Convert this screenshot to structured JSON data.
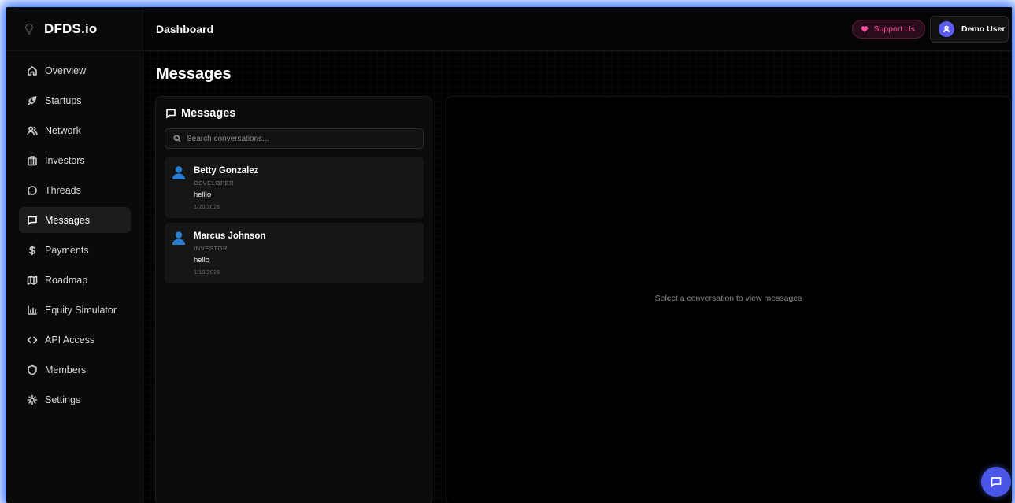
{
  "brand": {
    "name": "DFDS.io"
  },
  "sidebar": {
    "items": [
      {
        "label": "Overview",
        "icon": "home-icon"
      },
      {
        "label": "Startups",
        "icon": "rocket-icon"
      },
      {
        "label": "Network",
        "icon": "users-icon"
      },
      {
        "label": "Investors",
        "icon": "building-icon"
      },
      {
        "label": "Threads",
        "icon": "chat-bubble-icon"
      },
      {
        "label": "Messages",
        "icon": "message-square-icon",
        "active": true
      },
      {
        "label": "Payments",
        "icon": "dollar-icon"
      },
      {
        "label": "Roadmap",
        "icon": "map-icon"
      },
      {
        "label": "Equity Simulator",
        "icon": "bar-chart-icon"
      },
      {
        "label": "API Access",
        "icon": "code-icon"
      },
      {
        "label": "Members",
        "icon": "shield-icon"
      },
      {
        "label": "Settings",
        "icon": "gear-icon"
      }
    ]
  },
  "header": {
    "title": "Dashboard",
    "support_label": "Support Us",
    "user_name": "Demo User"
  },
  "main": {
    "page_title": "Messages",
    "conversations_title": "Messages",
    "search_placeholder": "Search conversations...",
    "conversations": [
      {
        "name": "Betty Gonzalez",
        "role": "DEVELOPER",
        "message": "helllo",
        "date": "1/20/2026"
      },
      {
        "name": "Marcus Johnson",
        "role": "INVESTOR",
        "message": "hello",
        "date": "1/19/2026"
      }
    ],
    "empty_state": "Select a conversation to view messages"
  },
  "colors": {
    "accent": "#4a56e8",
    "support": "#ff4f9f",
    "glow": "#1e5aff"
  }
}
